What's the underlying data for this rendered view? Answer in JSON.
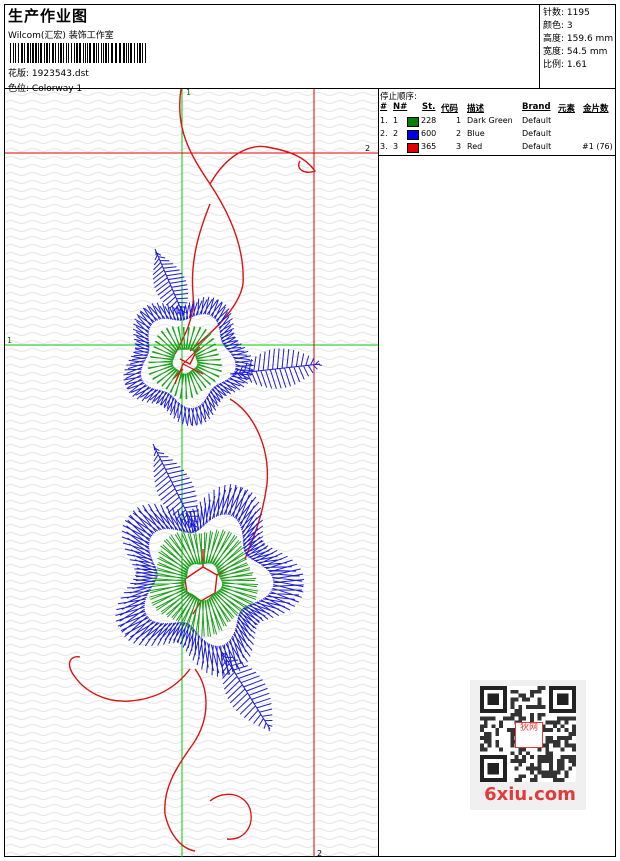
{
  "header": {
    "title": "生产作业图",
    "company": "Wilcom(汇宏) 装饰工作室",
    "design_label": "花版:",
    "design_value": "1923543.dst",
    "colorway_label": "色位:",
    "colorway_value": "Colorway 1"
  },
  "stats": [
    {
      "label": "针数:",
      "value": "1195"
    },
    {
      "label": "颜色:",
      "value": "3"
    },
    {
      "label": "高度:",
      "value": "159.6 mm"
    },
    {
      "label": "宽度:",
      "value": "54.5 mm"
    },
    {
      "label": "比例:",
      "value": "1.61"
    }
  ],
  "guides": {
    "v1_label": "1",
    "v2_label": "2",
    "h1_label": "1",
    "h2_label": "2",
    "green": "#00c800",
    "red": "#e00000"
  },
  "stop_table": {
    "title": "停止顺序:",
    "headers": {
      "num": "#",
      "n": "N#",
      "st": "St.",
      "code": "代码",
      "desc": "描述",
      "brand": "Brand",
      "element": "元素",
      "sequin": "金片数"
    },
    "rows": [
      {
        "num": "1.",
        "n": "1",
        "color": "#008000",
        "st": "228",
        "code": "1",
        "desc": "Dark Green",
        "brand": "Default",
        "sequin": ""
      },
      {
        "num": "2.",
        "n": "2",
        "color": "#0000e6",
        "st": "600",
        "code": "2",
        "desc": "Blue",
        "brand": "Default",
        "sequin": ""
      },
      {
        "num": "3.",
        "n": "3",
        "color": "#e00000",
        "st": "365",
        "code": "3",
        "desc": "Red",
        "brand": "Default",
        "sequin": "#1 (76)"
      }
    ]
  },
  "watermark": {
    "badge": "狄网",
    "text": "6xiu.com"
  },
  "colors": {
    "blue": "#1c1cd6",
    "green": "#1ca01c",
    "red": "#dd1111"
  }
}
